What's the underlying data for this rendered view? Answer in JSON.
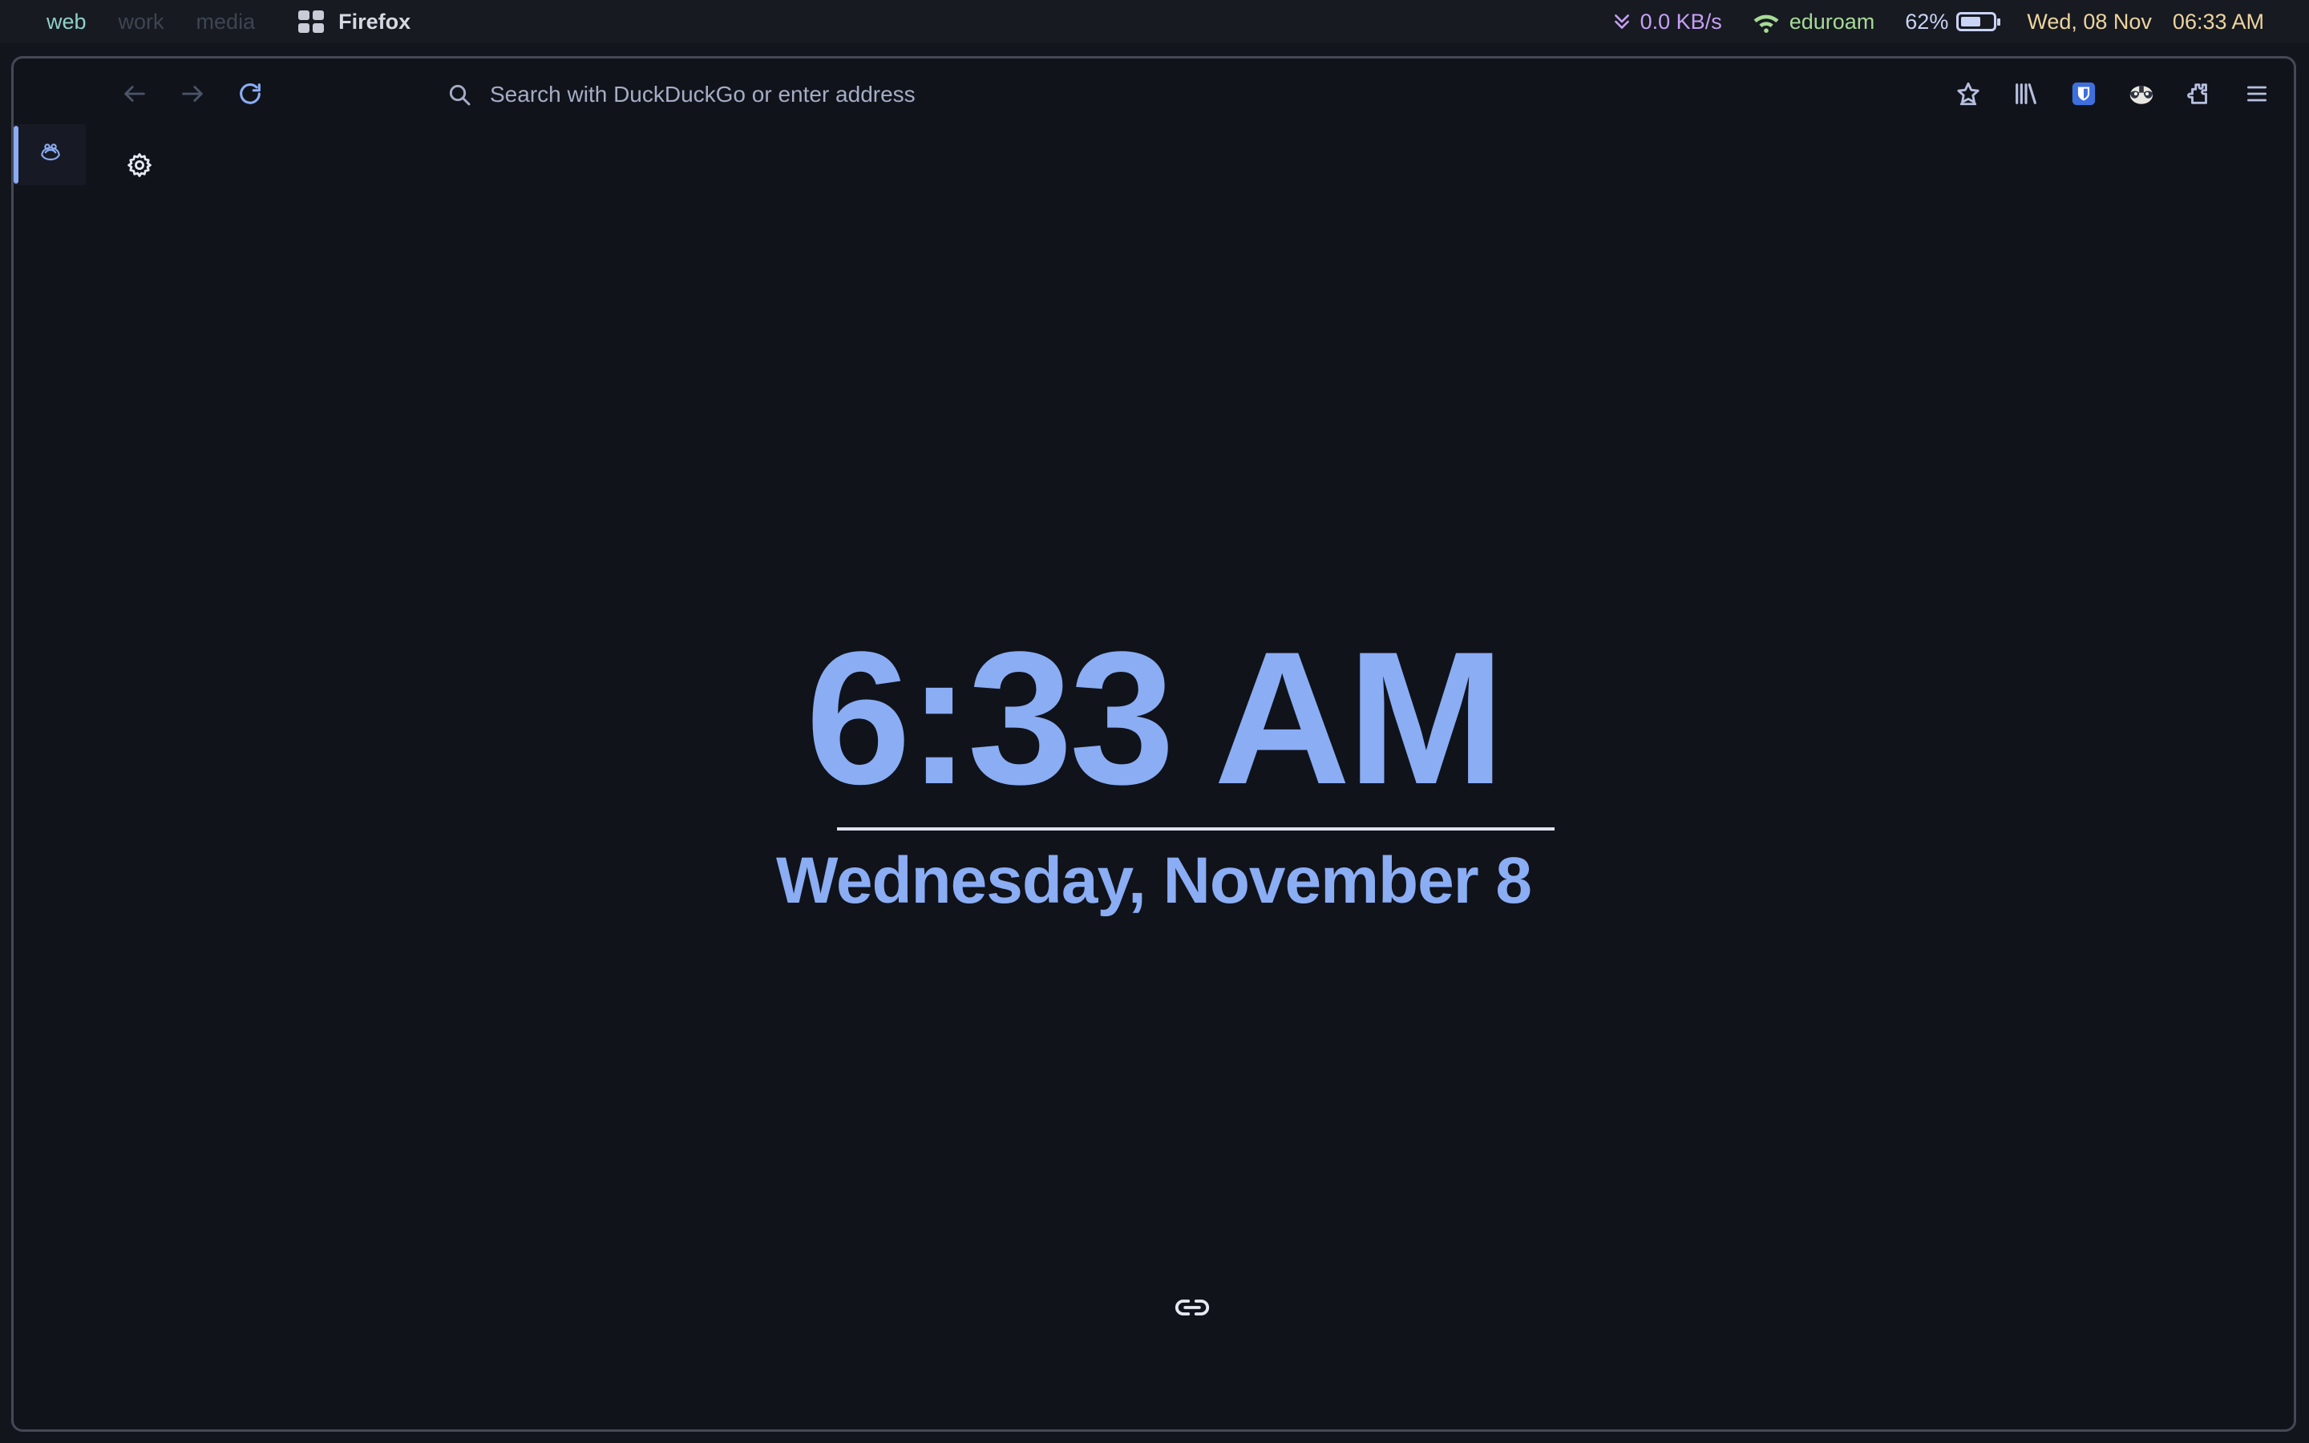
{
  "statusbar": {
    "workspaces": [
      {
        "label": "web",
        "active": true
      },
      {
        "label": "work",
        "active": false
      },
      {
        "label": "media",
        "active": false
      }
    ],
    "app_title": "Firefox",
    "network_speed": "0.0 KB/s",
    "wifi_name": "eduroam",
    "battery_percent": "62%",
    "battery_level": 0.62,
    "date": "Wed, 08 Nov",
    "time": "06:33 AM"
  },
  "browser": {
    "search_placeholder": "Search with DuckDuckGo or enter address",
    "toolbar_icons": [
      "bookmark-star-icon",
      "library-icon",
      "bitwarden-icon",
      "privacy-badger-icon",
      "extensions-icon",
      "menu-icon"
    ]
  },
  "newtab": {
    "time": "6:33 AM",
    "date": "Wednesday, November 8"
  },
  "colors": {
    "accent": "#8aadf4",
    "background": "#11131b",
    "active_workspace": "#8fd0c8",
    "network": "#c6a0f6",
    "wifi": "#a6da95",
    "clock": "#eed49f"
  }
}
